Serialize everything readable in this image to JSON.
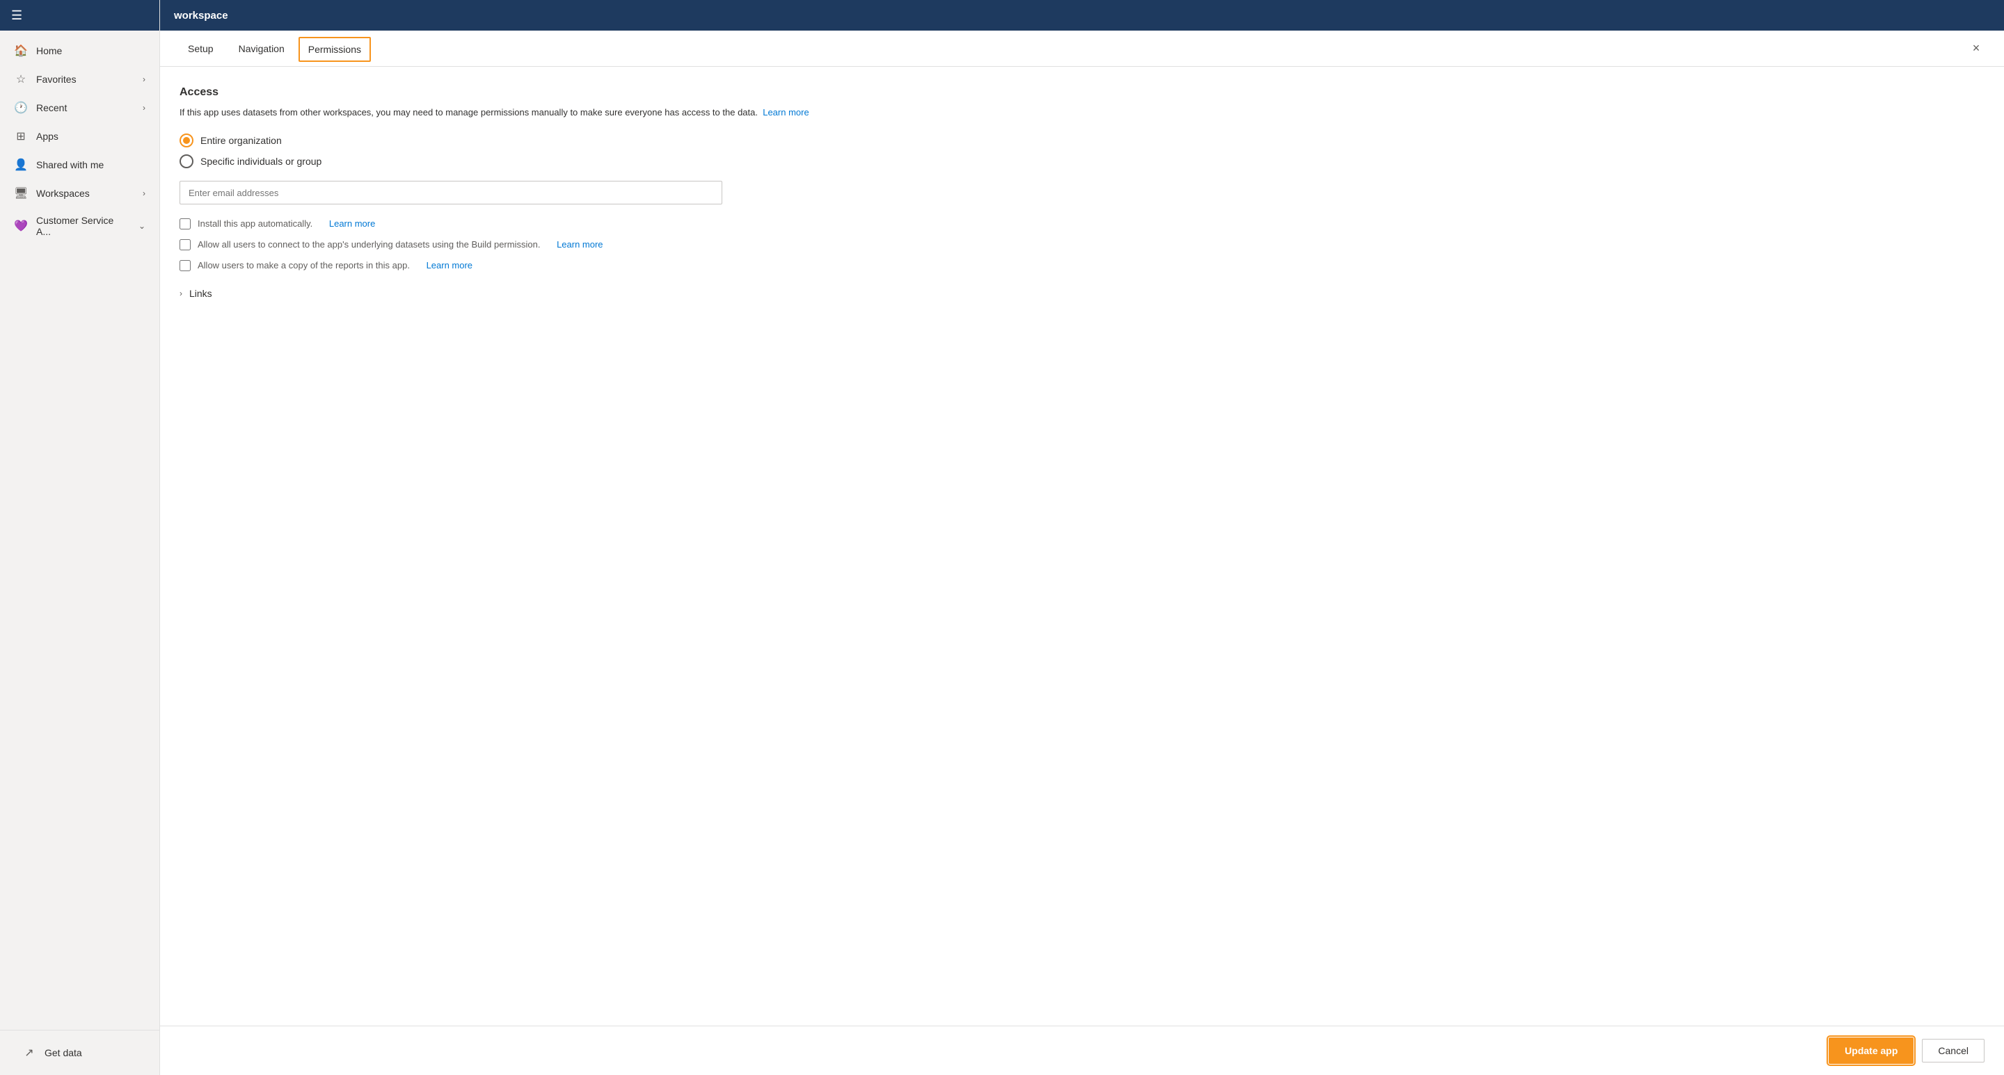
{
  "topbar": {
    "title": "workspace"
  },
  "sidebar": {
    "hamburger": "☰",
    "items": [
      {
        "id": "home",
        "icon": "🏠",
        "label": "Home",
        "hasChevron": false
      },
      {
        "id": "favorites",
        "icon": "☆",
        "label": "Favorites",
        "hasChevron": true
      },
      {
        "id": "recent",
        "icon": "🕐",
        "label": "Recent",
        "hasChevron": true
      },
      {
        "id": "apps",
        "icon": "⊞",
        "label": "Apps",
        "hasChevron": false
      },
      {
        "id": "shared",
        "icon": "👤",
        "label": "Shared with me",
        "hasChevron": false
      },
      {
        "id": "workspaces",
        "icon": "🖥",
        "label": "Workspaces",
        "hasChevron": true
      },
      {
        "id": "customer-service",
        "icon": "💜",
        "label": "Customer Service A...",
        "hasChevron": true,
        "isCustomer": true
      }
    ],
    "footer": {
      "id": "get-data",
      "icon": "↗",
      "label": "Get data"
    }
  },
  "panel": {
    "tabs": [
      {
        "id": "setup",
        "label": "Setup",
        "active": false
      },
      {
        "id": "navigation",
        "label": "Navigation",
        "active": false
      },
      {
        "id": "permissions",
        "label": "Permissions",
        "active": true
      }
    ],
    "close_label": "×",
    "access": {
      "title": "Access",
      "description": "If this app uses datasets from other workspaces, you may need to manage permissions manually to make sure everyone has access to the data.",
      "learn_more_label": "Learn more",
      "radio_options": [
        {
          "id": "entire-org",
          "label": "Entire organization",
          "selected": true
        },
        {
          "id": "specific-individuals",
          "label": "Specific individuals or group",
          "selected": false
        }
      ],
      "email_placeholder": "Enter email addresses",
      "checkboxes": [
        {
          "id": "install-auto",
          "label": "Install this app automatically.",
          "learn_more": "Learn more",
          "checked": false
        },
        {
          "id": "allow-build",
          "label": "Allow all users to connect to the app's underlying datasets using the Build permission.",
          "learn_more": "Learn more",
          "checked": false
        },
        {
          "id": "allow-copy",
          "label": "Allow users to make a copy of the reports in this app.",
          "learn_more": "Learn more",
          "checked": false
        }
      ]
    },
    "links_section": {
      "label": "Links",
      "chevron": "›"
    },
    "footer": {
      "update_app_label": "Update app",
      "cancel_label": "Cancel"
    }
  }
}
